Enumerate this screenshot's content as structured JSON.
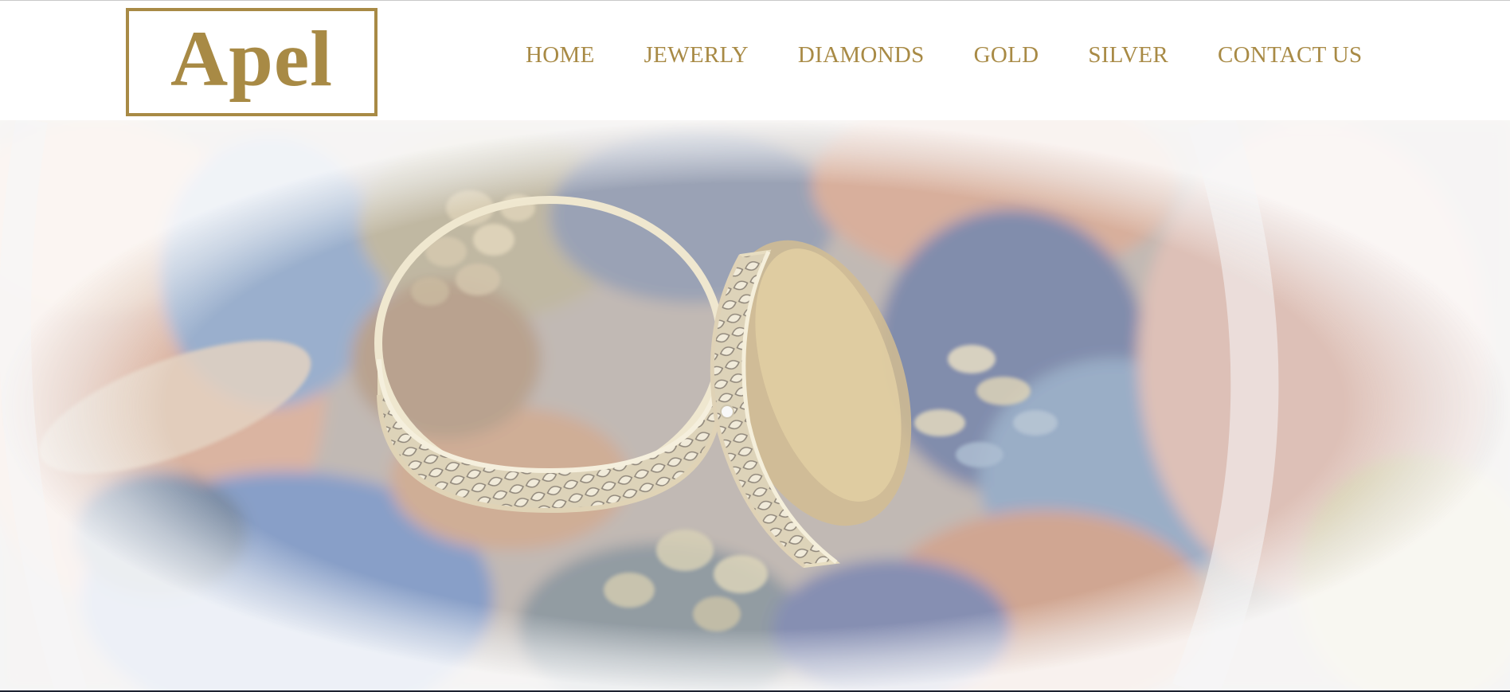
{
  "brand": {
    "logo_text": "Apel",
    "accent_color": "#a88a45"
  },
  "nav": {
    "items": [
      {
        "label": "HOME"
      },
      {
        "label": "JEWERLY"
      },
      {
        "label": "DIAMONDS"
      },
      {
        "label": "GOLD"
      },
      {
        "label": "SILVER"
      },
      {
        "label": "CONTACT US"
      }
    ]
  },
  "hero": {
    "image": "hero-rings-photo",
    "overlay": "washed-out-white"
  }
}
